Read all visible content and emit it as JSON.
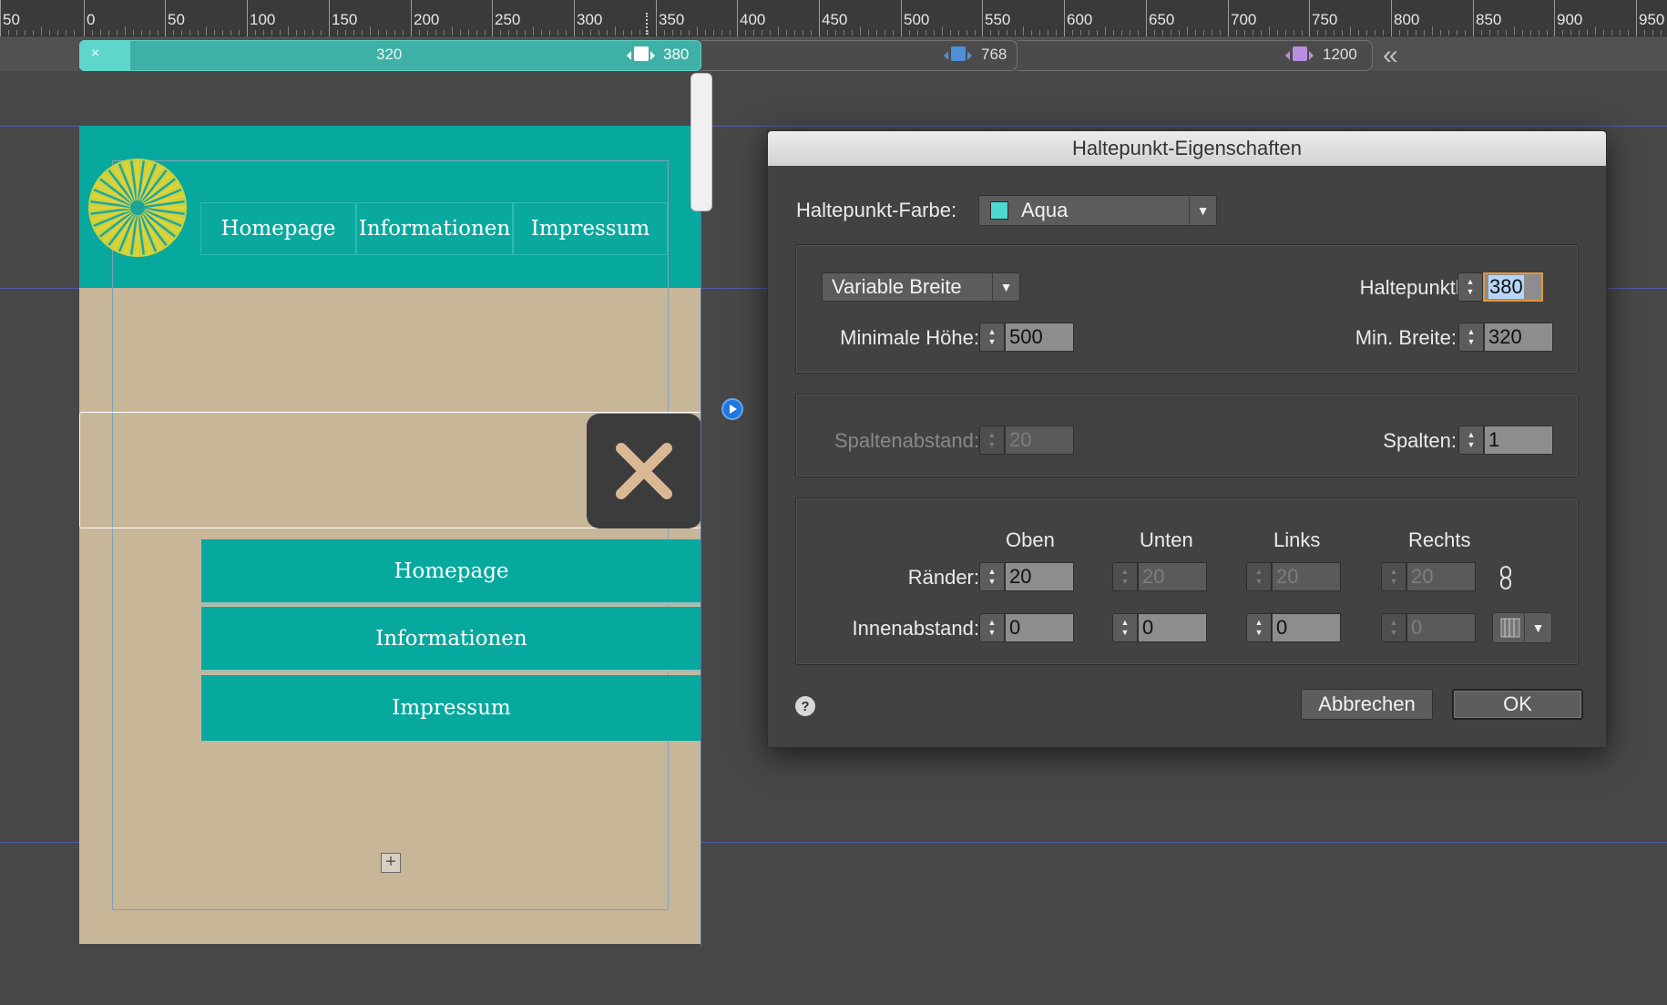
{
  "ruler": {
    "labels": [
      "50",
      "0",
      "50",
      "100",
      "150",
      "200",
      "250",
      "300",
      "350",
      "400",
      "450",
      "500",
      "550",
      "600",
      "650",
      "700",
      "750",
      "800",
      "850",
      "900",
      "950"
    ]
  },
  "breakpoints": {
    "close_symbol": "×",
    "main_width": "320",
    "current": "380",
    "tablet": "768",
    "desktop": "1200",
    "marker_colors": {
      "current": "#ffffff",
      "tablet": "#4f8fd6",
      "desktop": "#b98ee0"
    },
    "collapse_symbol": "«"
  },
  "canvas": {
    "nav_top": [
      "Homepage",
      "Informationen",
      "Impressum"
    ],
    "nav_vertical": [
      "Homepage",
      "Informationen",
      "Impressum"
    ],
    "plus_symbol": "+",
    "colors": {
      "teal": "#07a89e",
      "beige": "#c8b699"
    }
  },
  "dialog": {
    "title": "Haltepunkt-Eigenschaften",
    "farbe_label": "Haltepunkt-Farbe:",
    "farbe_value": "Aqua",
    "farbe_color": "#4fd8cf",
    "breite_mode": "Variable Breite",
    "haltepunktbreite_label": "Haltepunktbreite:",
    "haltepunktbreite_value": "380",
    "min_hoehe_label": "Minimale Höhe:",
    "min_hoehe_value": "500",
    "min_breite_label": "Min. Breite:",
    "min_breite_value": "320",
    "spaltenabstand_label": "Spaltenabstand:",
    "spaltenabstand_value": "20",
    "spalten_label": "Spalten:",
    "spalten_value": "1",
    "col_headers": [
      "Oben",
      "Unten",
      "Links",
      "Rechts"
    ],
    "raender_label": "Ränder:",
    "raender_values": [
      "20",
      "20",
      "20",
      "20"
    ],
    "innenabstand_label": "Innenabstand:",
    "innenabstand_values": [
      "0",
      "0",
      "0",
      "0"
    ],
    "help_symbol": "?",
    "cancel_label": "Abbrechen",
    "ok_label": "OK"
  }
}
